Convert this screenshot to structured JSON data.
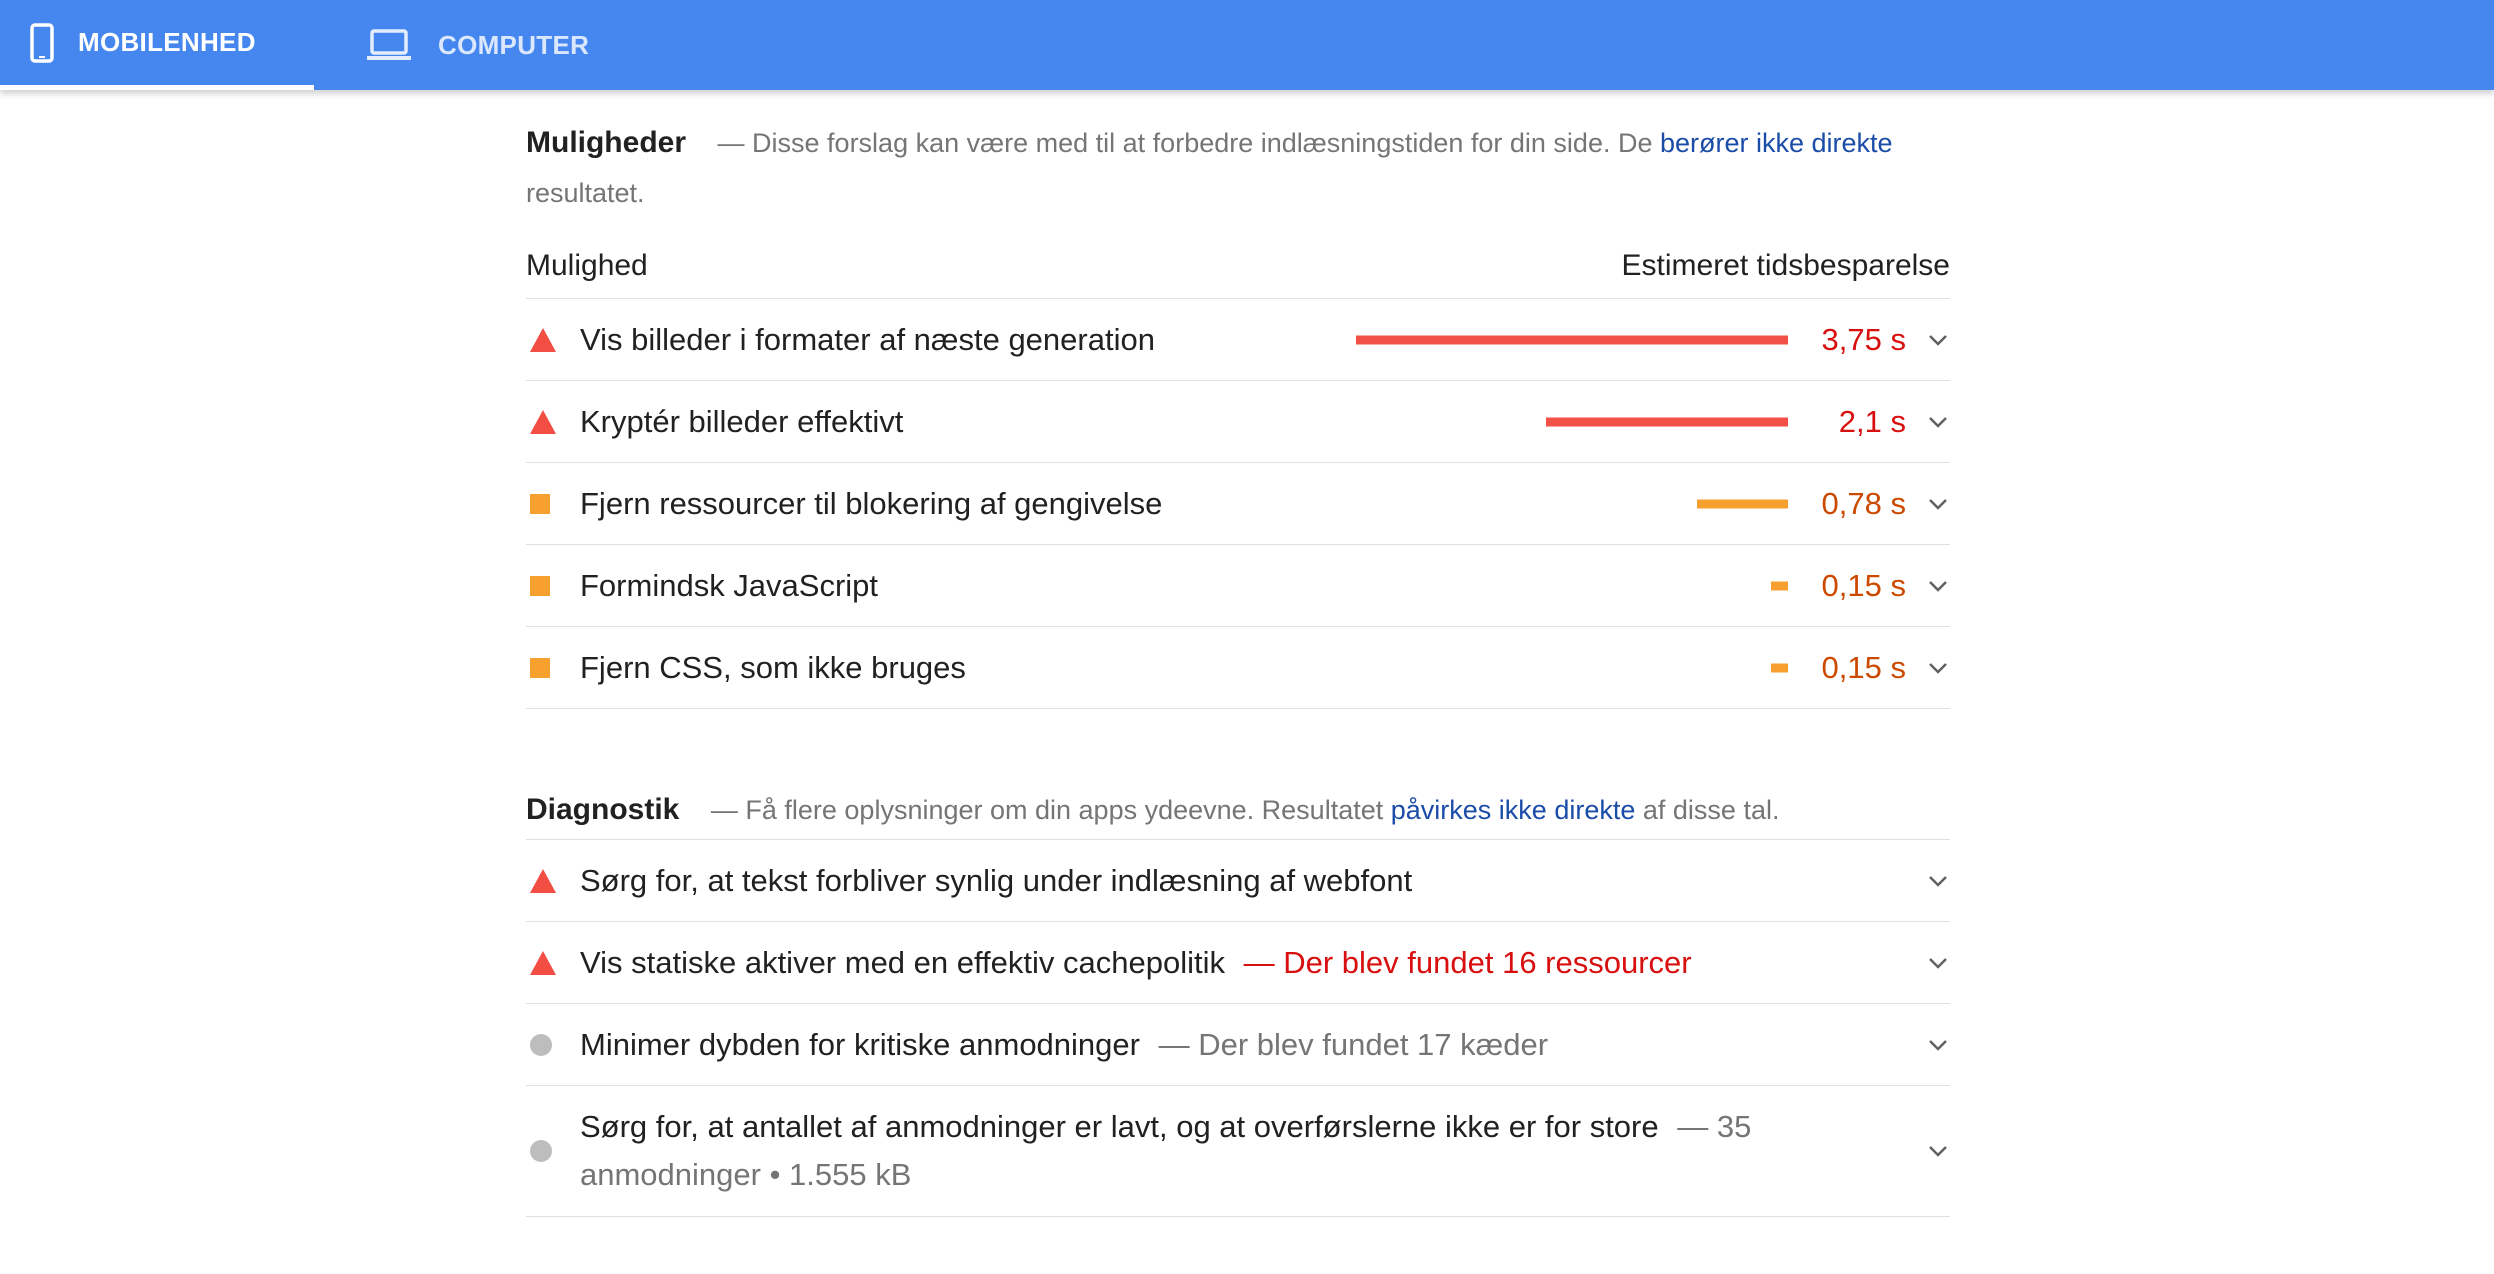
{
  "tabs": {
    "mobile_label": "MOBILENHED",
    "computer_label": "COMPUTER",
    "active": "mobile"
  },
  "opportunities": {
    "title": "Muligheder",
    "description_prefix": "— Disse forslag kan være med til at forbedre indlæsningstiden for din side. De",
    "description_link": "berører ikke direkte",
    "description_suffix": "resultatet.",
    "col_opportunity": "Mulighed",
    "col_savings": "Estimeret tidsbesparelse",
    "items": [
      {
        "severity": "fail",
        "title": "Vis billeder i formater af næste generation",
        "savings": "3,75 s",
        "bar_fraction": 1.0
      },
      {
        "severity": "fail",
        "title": "Kryptér billeder effektivt",
        "savings": "2,1 s",
        "bar_fraction": 0.56
      },
      {
        "severity": "average",
        "title": "Fjern ressourcer til blokering af gengivelse",
        "savings": "0,78 s",
        "bar_fraction": 0.21
      },
      {
        "severity": "average",
        "title": "Formindsk JavaScript",
        "savings": "0,15 s",
        "bar_fraction": 0.04
      },
      {
        "severity": "average",
        "title": "Fjern CSS, som ikke bruges",
        "savings": "0,15 s",
        "bar_fraction": 0.04
      }
    ]
  },
  "diagnostics": {
    "title": "Diagnostik",
    "description_prefix": "— Få flere oplysninger om din apps ydeevne. Resultatet",
    "description_link": "påvirkes ikke direkte",
    "description_suffix": "af disse tal.",
    "items": [
      {
        "severity": "fail",
        "title": "Sørg for, at tekst forbliver synlig under indlæsning af webfont",
        "detail": ""
      },
      {
        "severity": "fail",
        "title": "Vis statiske aktiver med en effektiv cachepolitik",
        "detail": "— Der blev fundet 16 ressourcer"
      },
      {
        "severity": "info",
        "title": "Minimer dybden for kritiske anmodninger",
        "detail": "— Der blev fundet 17 kæder"
      },
      {
        "severity": "info",
        "title": "Sørg for, at antallet af anmodninger er lavt, og at overførslerne ikke er for store",
        "detail": "— 35 anmodninger • 1.555 kB"
      }
    ]
  },
  "colors": {
    "topbar": "#4587ef",
    "fail": "#f24e44",
    "average": "#f7a030",
    "info": "#bdbdbd",
    "link": "#1a4ca8"
  },
  "icons": {
    "mobile_tab": "smartphone-icon",
    "computer_tab": "laptop-icon",
    "expand": "chevron-down-icon"
  }
}
